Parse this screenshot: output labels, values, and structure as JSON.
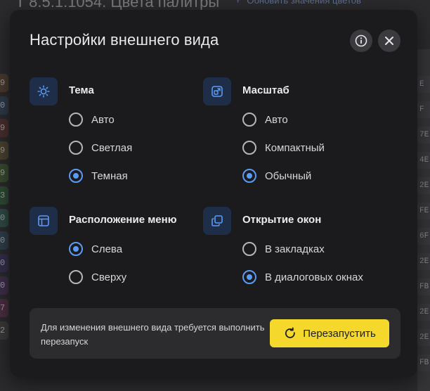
{
  "background": {
    "title": "T 8.5.1.1054. Цвета палитры",
    "update_link": "Обновить значения цветов",
    "left_chips": [
      {
        "text": "9",
        "color": "#4a3a2e"
      },
      {
        "text": "0",
        "color": "#2e3a4a"
      },
      {
        "text": "9",
        "color": "#4a2e2e"
      },
      {
        "text": "9",
        "color": "#4a4230"
      },
      {
        "text": "9",
        "color": "#3a4a2e"
      },
      {
        "text": "3",
        "color": "#2e4a34"
      },
      {
        "text": "0",
        "color": "#2e4a44"
      },
      {
        "text": "0",
        "color": "#2e3e4a"
      },
      {
        "text": "0",
        "color": "#342e4a"
      },
      {
        "text": "0",
        "color": "#3e2e4a"
      },
      {
        "text": "7",
        "color": "#4a2e42"
      },
      {
        "text": "2",
        "color": "#3a3a3a"
      }
    ],
    "right_chips": [
      "E",
      "F",
      "7E",
      "4E",
      "2E",
      "FE",
      "6F",
      "2E",
      "FB",
      "2E",
      "2E",
      "FB"
    ]
  },
  "dialog": {
    "title": "Настройки внешнего вида",
    "info_icon": "info-icon",
    "close_icon": "close-icon",
    "accent_color": "#5b9bf5",
    "groups": {
      "theme": {
        "icon": "sun-icon",
        "title": "Тема",
        "options": [
          {
            "label": "Авто",
            "checked": false
          },
          {
            "label": "Светлая",
            "checked": false
          },
          {
            "label": "Темная",
            "checked": true
          }
        ]
      },
      "scale": {
        "icon": "scale-icon",
        "title": "Масштаб",
        "options": [
          {
            "label": "Авто",
            "checked": false
          },
          {
            "label": "Компактный",
            "checked": false
          },
          {
            "label": "Обычный",
            "checked": true
          }
        ]
      },
      "menu": {
        "icon": "layout-icon",
        "title": "Расположение меню",
        "options": [
          {
            "label": "Слева",
            "checked": true
          },
          {
            "label": "Сверху",
            "checked": false
          }
        ]
      },
      "windows": {
        "icon": "windows-icon",
        "title": "Открытие окон",
        "options": [
          {
            "label": "В закладках",
            "checked": false
          },
          {
            "label": "В диалоговых окнах",
            "checked": true
          }
        ]
      }
    },
    "notice": {
      "text": "Для изменения внешнего вида требуется выполнить перезапуск",
      "button_label": "Перезапустить",
      "button_icon": "restart-icon",
      "button_color": "#f5d82c"
    }
  }
}
